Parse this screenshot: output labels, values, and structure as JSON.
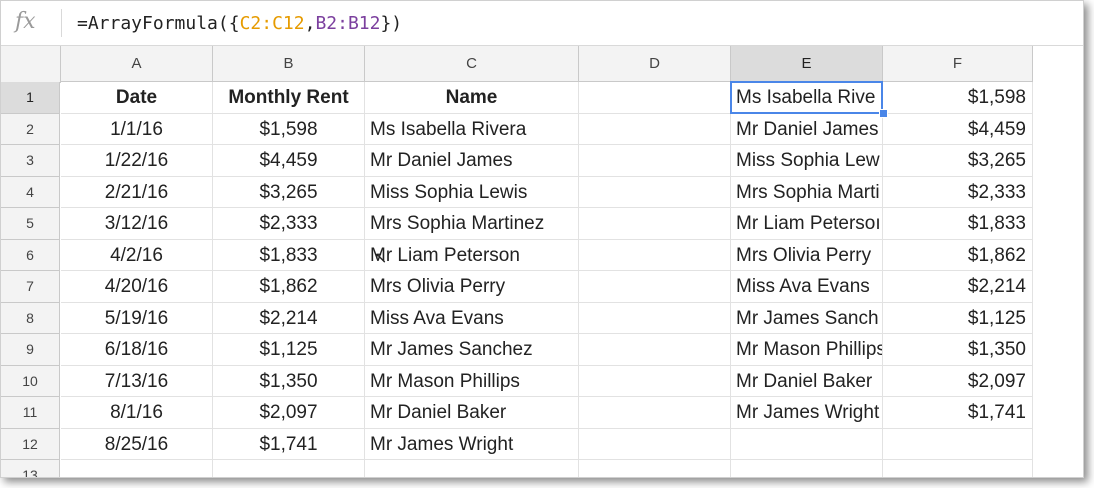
{
  "formula_bar": {
    "icon": "fx",
    "prefix": "=ArrayFormula({",
    "range1": "C2:C12",
    "comma": ",",
    "range2": "B2:B12",
    "suffix": "})"
  },
  "columns": [
    "A",
    "B",
    "C",
    "D",
    "E",
    "F"
  ],
  "rows": [
    "1",
    "2",
    "3",
    "4",
    "5",
    "6",
    "7",
    "8",
    "9",
    "10",
    "11",
    "12",
    "13"
  ],
  "headers": {
    "date": "Date",
    "rent": "Monthly Rent",
    "name": "Name"
  },
  "table": [
    {
      "date": "1/1/16",
      "rent": "$1,598",
      "name": "Ms Isabella Rivera",
      "e": "Mr Daniel James",
      "f": "$4,459"
    },
    {
      "date": "1/22/16",
      "rent": "$4,459",
      "name": "Mr Daniel James",
      "e": "Miss Sophia Lew",
      "f": "$3,265"
    },
    {
      "date": "2/21/16",
      "rent": "$3,265",
      "name": "Miss Sophia Lewis",
      "e": "Mrs Sophia Marti",
      "f": "$2,333"
    },
    {
      "date": "3/12/16",
      "rent": "$2,333",
      "name": "Mrs Sophia Martinez",
      "e": "Mr Liam Petersoı",
      "f": "$1,833"
    },
    {
      "date": "4/2/16",
      "rent": "$1,833",
      "name": "Mr Liam Peterson",
      "e": "Mrs Olivia Perry",
      "f": "$1,862"
    },
    {
      "date": "4/20/16",
      "rent": "$1,862",
      "name": "Mrs Olivia Perry",
      "e": "Miss Ava Evans",
      "f": "$2,214"
    },
    {
      "date": "5/19/16",
      "rent": "$2,214",
      "name": "Miss Ava Evans",
      "e": "Mr James Sanch",
      "f": "$1,125"
    },
    {
      "date": "6/18/16",
      "rent": "$1,125",
      "name": "Mr James Sanchez",
      "e": "Mr Mason Phillips",
      "f": "$1,350"
    },
    {
      "date": "7/13/16",
      "rent": "$1,350",
      "name": "Mr Mason Phillips",
      "e": "Mr Daniel Baker",
      "f": "$2,097"
    },
    {
      "date": "8/1/16",
      "rent": "$2,097",
      "name": "Mr Daniel Baker",
      "e": "Mr James Wright",
      "f": "$1,741"
    },
    {
      "date": "8/25/16",
      "rent": "$1,741",
      "name": "Mr James Wright",
      "e": "",
      "f": ""
    }
  ],
  "row1_e": "Ms Isabella Rive",
  "row1_f": "$1,598",
  "selected_cell": "E1",
  "colors": {
    "selection": "#4a86e8",
    "range1": "#e69b00",
    "range2": "#7b3f9e"
  }
}
